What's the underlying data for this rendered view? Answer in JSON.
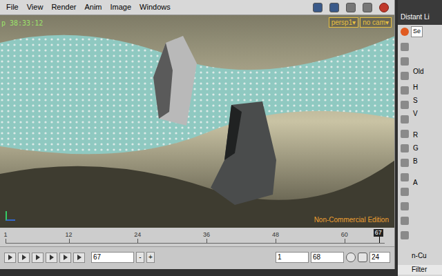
{
  "window": {
    "menu": [
      "File",
      "View",
      "Render",
      "Anim",
      "Image",
      "Windows"
    ]
  },
  "viewport": {
    "timecode": "p 38:33:12",
    "camera_menus": [
      "persp1▾",
      "no cam▾"
    ],
    "watermark": "Non-Commercial Edition"
  },
  "timeline": {
    "ticks": [
      "1",
      "12",
      "24",
      "36",
      "48",
      "60"
    ],
    "current_frame": "67",
    "level": 0.985
  },
  "controls": {
    "frame": "67",
    "minus": "-",
    "plus": "+",
    "start": "1",
    "end": "68",
    "fps": "24"
  },
  "side_panel": {
    "title": "Distant Li",
    "tab": "Se",
    "labels": [
      "Old",
      "H",
      "S",
      "V",
      "R",
      "G",
      "B",
      "A"
    ],
    "partial": "n-Cu",
    "filter": "Filter"
  }
}
